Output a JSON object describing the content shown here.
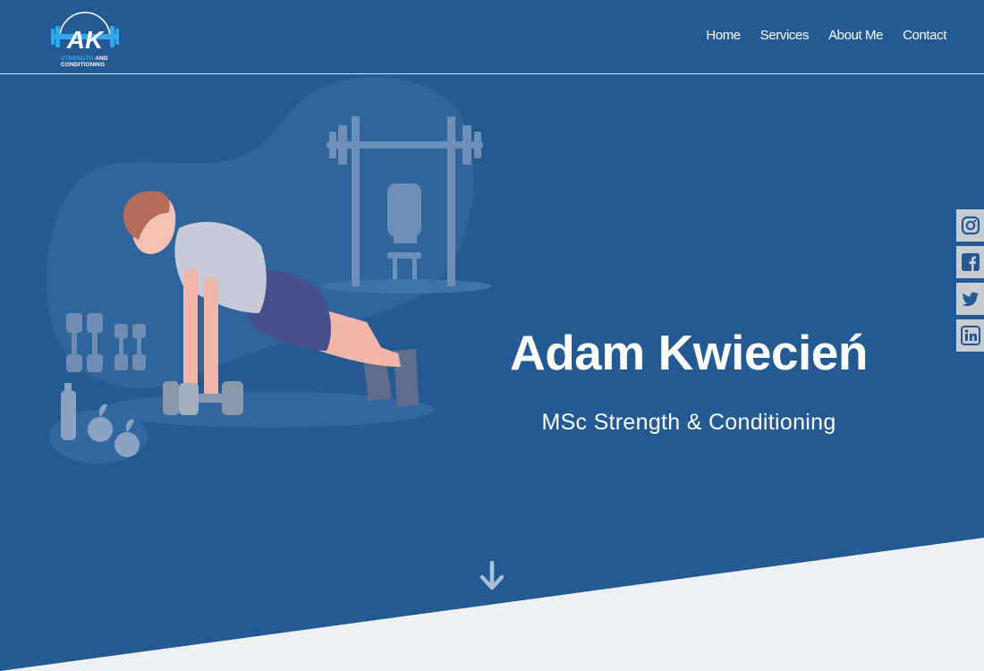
{
  "brand": {
    "logo_initials": "AK",
    "logo_line1_a": "STRENGTH",
    "logo_line1_b": "AND",
    "logo_line2": "CONDITIONING"
  },
  "nav": {
    "items": [
      {
        "label": "Home"
      },
      {
        "label": "Services"
      },
      {
        "label": "About Me"
      },
      {
        "label": "Contact"
      }
    ]
  },
  "hero": {
    "title": "Adam Kwiecień",
    "subtitle": "MSc Strength & Conditioning"
  },
  "social": {
    "items": [
      {
        "icon": "instagram-icon"
      },
      {
        "icon": "facebook-icon"
      },
      {
        "icon": "twitter-icon"
      },
      {
        "icon": "linkedin-icon"
      }
    ]
  },
  "colors": {
    "background": "#235a93",
    "accent": "#2fa8ee",
    "section_bottom": "#eef1f4"
  }
}
